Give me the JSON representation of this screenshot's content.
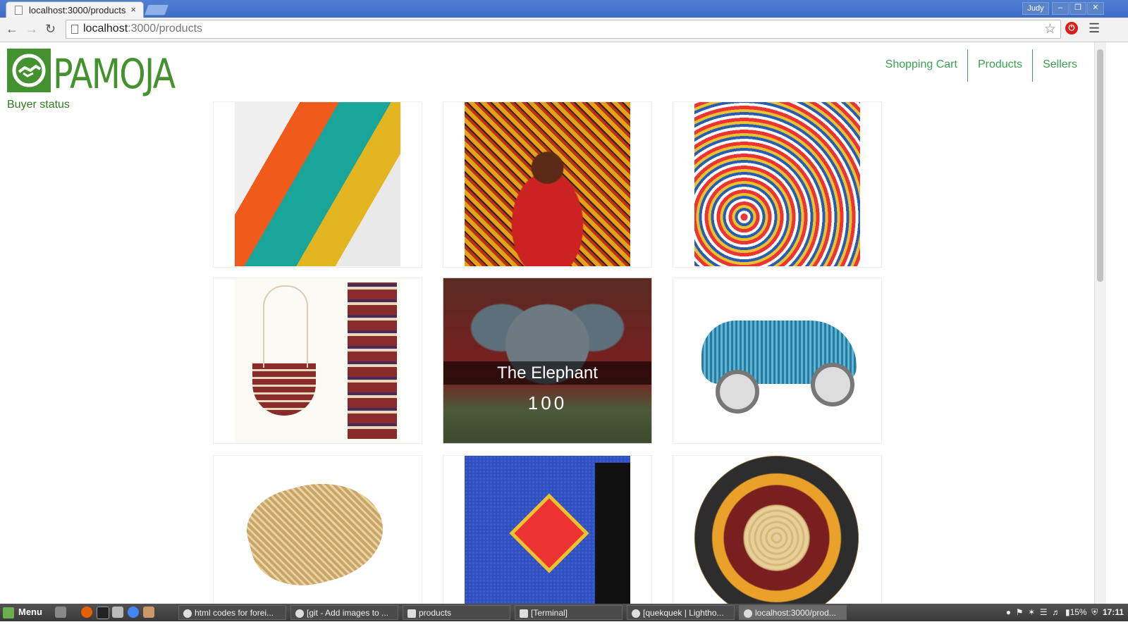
{
  "browser": {
    "tab_title": "localhost:3000/products",
    "tab_close": "×",
    "user": "Judy",
    "url_host": "localhost",
    "url_rest": ":3000/products",
    "window_buttons": {
      "minimize": "–",
      "restore": "❐",
      "close": "✕"
    }
  },
  "site": {
    "logo_text": "PAMOJA",
    "buyer_status": "Buyer status",
    "nav": [
      "Shopping Cart",
      "Products",
      "Sellers"
    ],
    "brand_color": "#43912f"
  },
  "products": {
    "hover_title": "The Elephant",
    "hover_price": "100"
  },
  "taskbar": {
    "menu_label": "Menu",
    "tasks": [
      "html codes for forei...",
      "[git - Add images to ...",
      "products",
      "[Terminal]",
      "[quekquek | Lightho...",
      "localhost:3000/prod..."
    ],
    "battery": "15%",
    "clock": "17:11"
  }
}
